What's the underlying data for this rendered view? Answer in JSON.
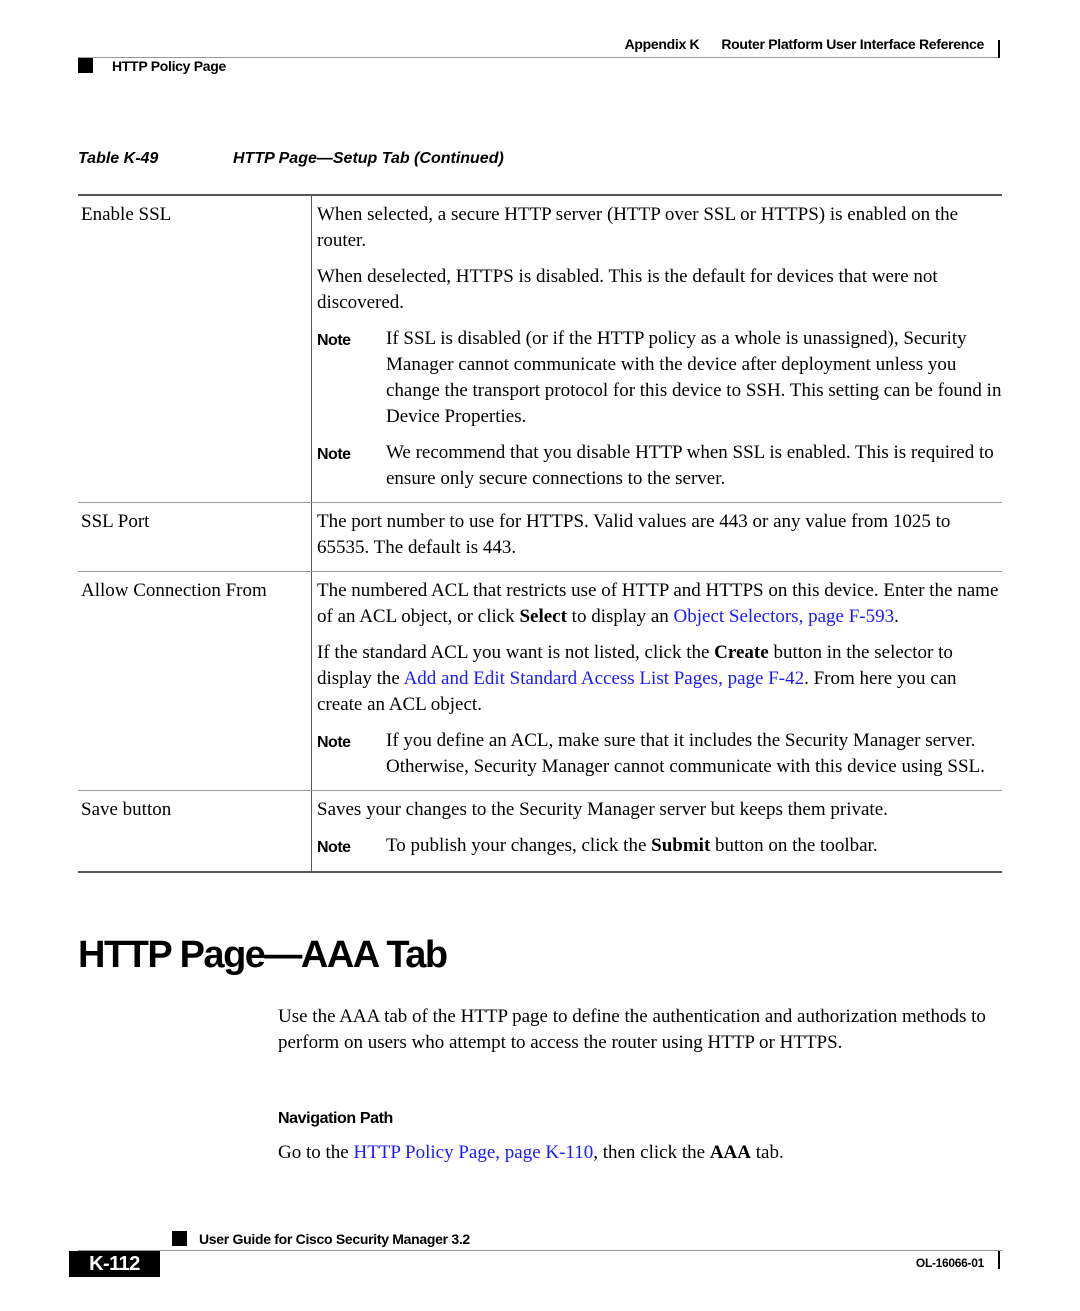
{
  "header": {
    "appendix": "Appendix K",
    "chapter_title": "Router Platform User Interface Reference",
    "section": "HTTP Policy Page"
  },
  "table": {
    "caption_number": "Table K-49",
    "caption_title": "HTTP Page—Setup Tab (Continued)",
    "rows": [
      {
        "term": "Enable SSL",
        "p1": "When selected, a secure HTTP server (HTTP over SSL or HTTPS) is enabled on the router.",
        "p2": "When deselected, HTTPS is disabled. This is the default for devices that were not discovered.",
        "note1_label": "Note",
        "note1": "If SSL is disabled (or if the HTTP policy as a whole is unassigned), Security Manager cannot communicate with the device after deployment unless you change the transport protocol for this device to SSH. This setting can be found in Device Properties.",
        "note2_label": "Note",
        "note2": "We recommend that you disable HTTP when SSL is enabled. This is required to ensure only secure connections to the server."
      },
      {
        "term": "SSL Port",
        "p1": "The port number to use for HTTPS. Valid values are 443 or any value from 1025 to 65535. The default is 443."
      },
      {
        "term": "Allow Connection From",
        "p1_a": "The numbered ACL that restricts use of HTTP and HTTPS on this device. Enter the name of an ACL object, or click ",
        "p1_bold": "Select",
        "p1_b": " to display an ",
        "p1_link": "Object Selectors, page F-593",
        "p1_c": ".",
        "p2_a": "If the standard ACL you want is not listed, click the ",
        "p2_bold": "Create",
        "p2_b": " button in the selector to display the ",
        "p2_link": "Add and Edit Standard Access List Pages, page F-42",
        "p2_c": ". From here you can create an ACL object.",
        "note1_label": "Note",
        "note1": "If you define an ACL, make sure that it includes the Security Manager server. Otherwise, Security Manager cannot communicate with this device using SSL."
      },
      {
        "term": "Save button",
        "p1": "Saves your changes to the Security Manager server but keeps them private.",
        "note1_label": "Note",
        "note1_a": "To publish your changes, click the ",
        "note1_bold": "Submit",
        "note1_b": " button on the toolbar."
      }
    ]
  },
  "section": {
    "heading": "HTTP Page—AAA Tab",
    "intro": "Use the AAA tab of the HTTP page to define the authentication and authorization methods to perform on users who attempt to access the router using HTTP or HTTPS.",
    "nav_heading": "Navigation Path",
    "nav_a": "Go to the ",
    "nav_link": "HTTP Policy Page, page K-110",
    "nav_b": ", then click the ",
    "nav_bold": "AAA",
    "nav_c": " tab."
  },
  "footer": {
    "guide_title": "User Guide for Cisco Security Manager 3.2",
    "page_number": "K-112",
    "doc_number": "OL-16066-01"
  },
  "colors": {
    "link": "#1a1aff"
  }
}
